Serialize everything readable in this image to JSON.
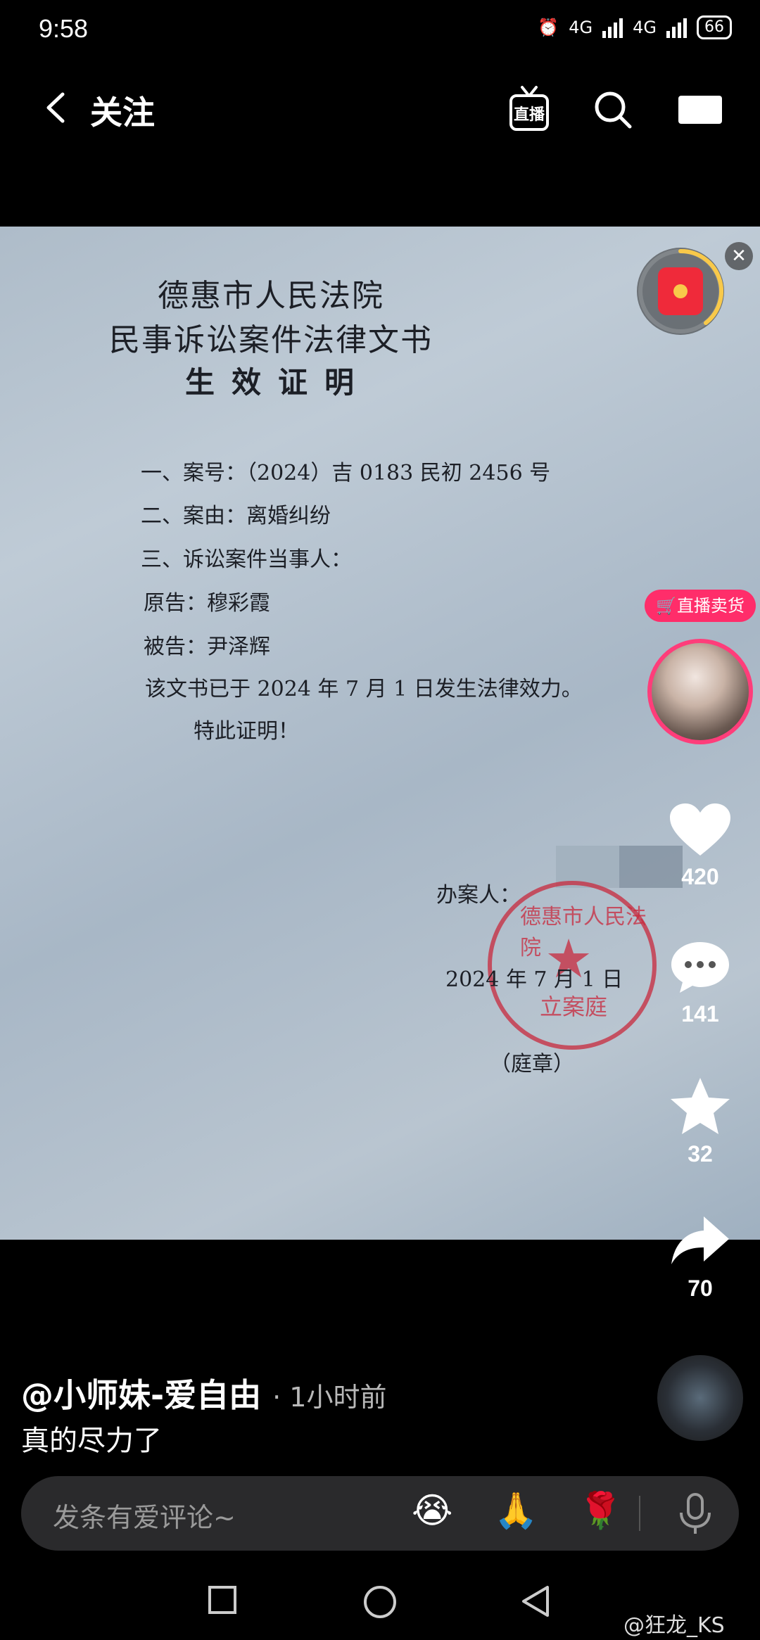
{
  "status_bar": {
    "time": "9:58",
    "network1": "4G",
    "network2": "4G",
    "battery": "66"
  },
  "nav": {
    "title": "关注"
  },
  "document": {
    "court": "德惠市人民法院",
    "doc_type": "民事诉讼案件法律文书",
    "cert_title": "生效证明",
    "case_no": "一、案号：（2024）吉 0183 民初 2456 号",
    "cause": "二、案由：离婚纠纷",
    "parties_header": "三、诉讼案件当事人：",
    "plaintiff": "原告：穆彩霞",
    "defendant": "被告：尹泽辉",
    "effective": "该文书已于 2024 年 7 月 1 日发生法律效力。",
    "certify": "特此证明！",
    "handler_label": "办案人：",
    "date_line": "2024 年 7 月 1 日",
    "seal_note": "（庭章）",
    "seal_text_top": "德惠市人民法院",
    "seal_text_bottom": "立案庭"
  },
  "sidebar": {
    "live_tag": "直播卖货",
    "likes": "420",
    "comments": "141",
    "favorites": "32",
    "shares": "70"
  },
  "post": {
    "author": "@小师妹-爱自由",
    "time": "· 1小时前",
    "caption": "真的尽力了"
  },
  "comment_bar": {
    "placeholder": "发条有爱评论~"
  },
  "watermark": "@狂龙_KS"
}
